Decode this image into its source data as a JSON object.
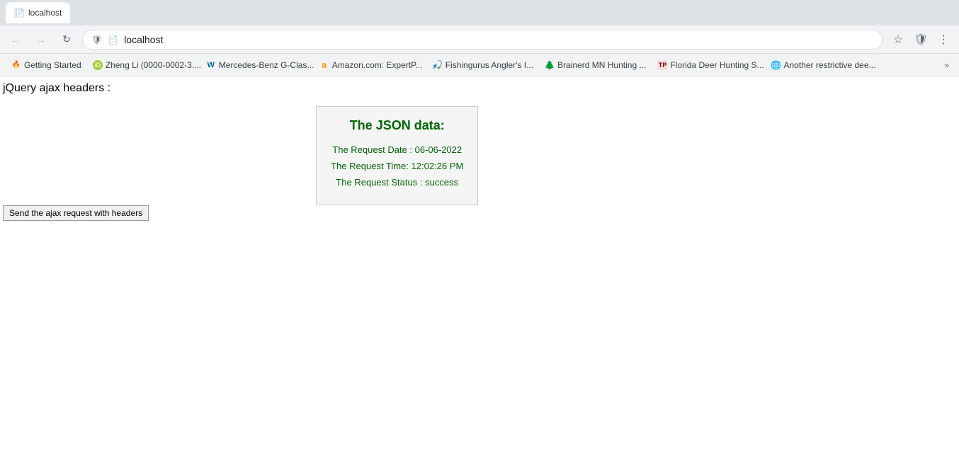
{
  "browser": {
    "tab": {
      "title": "localhost",
      "favicon": "🔒"
    },
    "address": "localhost",
    "toolbar": {
      "back_label": "←",
      "forward_label": "→",
      "refresh_label": "↻",
      "star_label": "☆",
      "shield_label": "🛡",
      "menu_label": "⋮"
    }
  },
  "bookmarks": [
    {
      "id": "getting-started",
      "label": "Getting Started",
      "favicon": "🔥",
      "type": "fire"
    },
    {
      "id": "zheng-li",
      "label": "Zheng Li (0000-0002-3....",
      "favicon": "ID",
      "type": "orcid"
    },
    {
      "id": "mercedes",
      "label": "Mercedes-Benz G-Clas...",
      "favicon": "W",
      "type": "w"
    },
    {
      "id": "amazon",
      "label": "Amazon.com: ExpertP...",
      "favicon": "a",
      "type": "amazon"
    },
    {
      "id": "fishingurus",
      "label": "Fishingurus Angler's I...",
      "favicon": "🐟",
      "type": "fish"
    },
    {
      "id": "brainerd",
      "label": "Brainerd MN Hunting ...",
      "favicon": "🌲",
      "type": "tree"
    },
    {
      "id": "florida-deer",
      "label": "Florida Deer Hunting S...",
      "favicon": "TP",
      "type": "tp"
    },
    {
      "id": "another",
      "label": "Another restrictive dee...",
      "favicon": "🌐",
      "type": "globe"
    }
  ],
  "page": {
    "heading": "jQuery ajax headers :",
    "json_box": {
      "title": "The JSON data:",
      "fields": [
        {
          "id": "date",
          "text": "The Request Date : 06-06-2022"
        },
        {
          "id": "time",
          "text": "The Request Time: 12:02:26 PM"
        },
        {
          "id": "status",
          "text": "The Request Status : success"
        }
      ]
    },
    "send_button_label": "Send the ajax request with headers"
  }
}
